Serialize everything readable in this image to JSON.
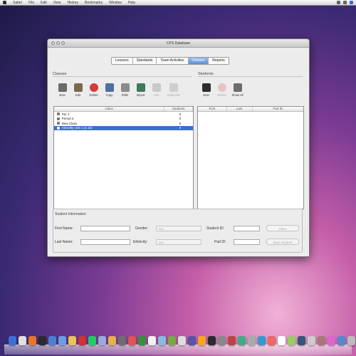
{
  "menubar": {
    "items": [
      "Safari",
      "File",
      "Edit",
      "View",
      "History",
      "Bookmarks",
      "Window",
      "Help"
    ]
  },
  "window": {
    "title": "CPS Database",
    "tabs": [
      {
        "label": "Lessons",
        "active": false
      },
      {
        "label": "Standards",
        "active": false
      },
      {
        "label": "Team Activities",
        "active": false
      },
      {
        "label": "Classes",
        "active": true
      },
      {
        "label": "Reports",
        "active": false
      }
    ],
    "classes": {
      "heading": "Classes",
      "toolbar": [
        {
          "label": "New",
          "icon": "new-class-icon",
          "color": "#6b6b6b",
          "disabled": false
        },
        {
          "label": "Edit",
          "icon": "edit-icon",
          "color": "#7a6a4a",
          "disabled": false
        },
        {
          "label": "Delete",
          "icon": "delete-icon",
          "color": "#d13b3b",
          "disabled": false
        },
        {
          "label": "Copy",
          "icon": "copy-icon",
          "color": "#4d6fa3",
          "disabled": false
        },
        {
          "label": "Rolls",
          "icon": "rolls-icon",
          "color": "#8a8a8a",
          "disabled": false
        },
        {
          "label": "Import",
          "icon": "import-icon",
          "color": "#3f7a5a",
          "disabled": false
        },
        {
          "label": "Add",
          "icon": "add-icon",
          "color": "#8a8a8a",
          "disabled": true
        },
        {
          "label": "Subscribe",
          "icon": "subscribe-icon",
          "color": "#9a9a9a",
          "disabled": true
        }
      ],
      "columns": [
        "Class",
        "Students"
      ],
      "rows": [
        {
          "name": "Per 1",
          "students": "0",
          "selected": false
        },
        {
          "name": "Period 2",
          "students": "0",
          "selected": false
        },
        {
          "name": "New Class",
          "students": "0",
          "selected": false
        },
        {
          "name": "Heredity Unit 1 (4.10)",
          "students": "0",
          "selected": true
        }
      ]
    },
    "students": {
      "heading": "Students",
      "toolbar": [
        {
          "label": "New",
          "icon": "new-student-icon",
          "color": "#2d2d2d",
          "disabled": false
        },
        {
          "label": "Delete",
          "icon": "delete-icon",
          "color": "#d87a7a",
          "disabled": true
        },
        {
          "label": "Show All",
          "icon": "show-all-icon",
          "color": "#6d6d6d",
          "disabled": false
        }
      ],
      "columns": [
        "First",
        "Last",
        "Pad ID"
      ]
    },
    "student_info": {
      "heading": "Student Information",
      "first_name_label": "First Name:",
      "last_name_label": "Last Name:",
      "gender_label": "Gender:",
      "ethnicity_label": "Ethnicity:",
      "student_id_label": "Student ID:",
      "pad_id_label": "Pad ID:",
      "gender_value": "N/A",
      "ethnicity_value": "N/A",
      "clear_button": "Clear",
      "save_button": "Save Student"
    }
  },
  "colors": {
    "accent": "#3a6fd0",
    "tab_active": "#5b8fd6"
  },
  "dock": {
    "icons": [
      "#3b6fd6",
      "#e0e0e0",
      "#e8762b",
      "#2a2a2a",
      "#4a7fd6",
      "#6a9fe6",
      "#e9c45a",
      "#c33",
      "#2c6",
      "#9ad",
      "#e4b34a",
      "#6e6e6e",
      "#d55",
      "#3a8f3a",
      "#f1f1f1",
      "#8bd",
      "#7a4",
      "#ddd",
      "#55a",
      "#f5a623",
      "#2b2b2b",
      "#888",
      "#b44",
      "#4a8",
      "#aaa",
      "#39c",
      "#e66",
      "#fff",
      "#9c6",
      "#357",
      "#ccc",
      "#a77",
      "#d6c",
      "#58c",
      "#bbb",
      "#6a6"
    ]
  }
}
